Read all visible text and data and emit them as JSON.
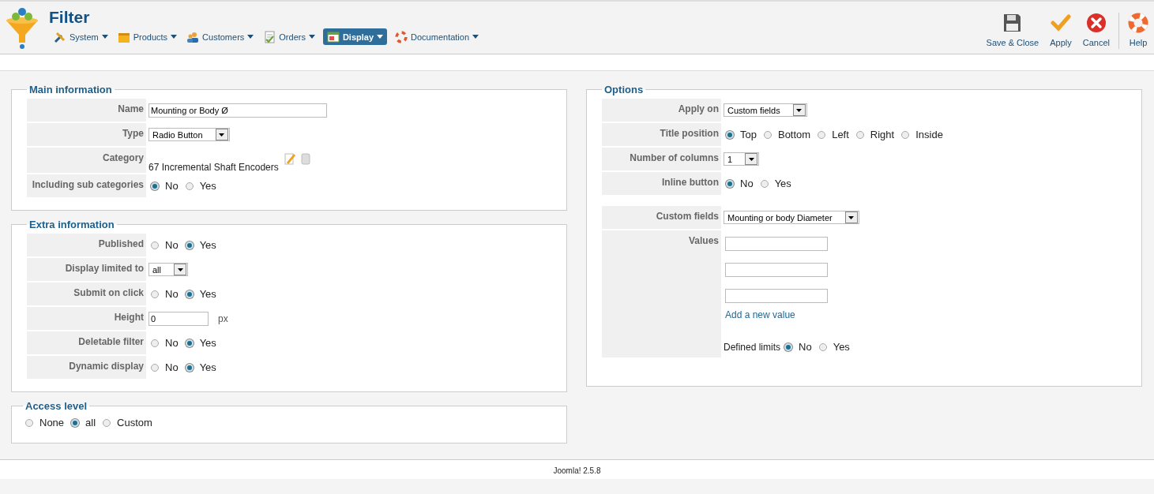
{
  "header": {
    "title": "Filter",
    "menu": [
      {
        "label": "System",
        "kind": "tools",
        "selected": false
      },
      {
        "label": "Products",
        "kind": "box",
        "selected": false
      },
      {
        "label": "Customers",
        "kind": "users",
        "selected": false
      },
      {
        "label": "Orders",
        "kind": "doc",
        "selected": false
      },
      {
        "label": "Display",
        "kind": "screen",
        "selected": true
      },
      {
        "label": "Documentation",
        "kind": "ring",
        "selected": false
      }
    ],
    "toolbar": [
      {
        "label": "Save & Close",
        "kind": "save"
      },
      {
        "label": "Apply",
        "kind": "apply"
      },
      {
        "label": "Cancel",
        "kind": "cancel"
      },
      {
        "label": "Help",
        "kind": "help"
      }
    ]
  },
  "left_panels": [
    {
      "title": "Main information",
      "rows": [
        {
          "kind": "text",
          "label": "Name",
          "value": "Mounting or Body Ø"
        },
        {
          "kind": "select",
          "label": "Type",
          "value": "Radio Button"
        },
        {
          "kind": "category",
          "label": "Category",
          "value": "67 Incremental Shaft Encoders"
        },
        {
          "kind": "radio",
          "label": "Including sub categories",
          "options": [
            {
              "label": "No",
              "selected": true
            },
            {
              "label": "Yes",
              "selected": false
            }
          ]
        }
      ]
    },
    {
      "title": "Extra information",
      "rows": [
        {
          "kind": "radio",
          "label": "Published",
          "options": [
            {
              "label": "No",
              "selected": false
            },
            {
              "label": "Yes",
              "selected": true
            }
          ]
        },
        {
          "kind": "select",
          "label": "Display limited to",
          "value": "all"
        },
        {
          "kind": "radio",
          "label": "Submit on click",
          "options": [
            {
              "label": "No",
              "selected": false
            },
            {
              "label": "Yes",
              "selected": true
            }
          ]
        },
        {
          "kind": "text",
          "label": "Height",
          "value": "0",
          "unit": "px"
        },
        {
          "kind": "radio",
          "label": "Deletable filter",
          "options": [
            {
              "label": "No",
              "selected": false
            },
            {
              "label": "Yes",
              "selected": true
            }
          ]
        },
        {
          "kind": "radio",
          "label": "Dynamic display",
          "options": [
            {
              "label": "No",
              "selected": false
            },
            {
              "label": "Yes",
              "selected": true
            }
          ]
        }
      ]
    }
  ],
  "access_level": {
    "title": "Access level",
    "options": [
      {
        "label": "None",
        "selected": false
      },
      {
        "label": "all",
        "selected": true
      },
      {
        "label": "Custom",
        "selected": false
      }
    ]
  },
  "options": {
    "title": "Options",
    "groups": [
      [
        {
          "kind": "select",
          "label": "Apply on",
          "value": "Custom fields"
        },
        {
          "kind": "radio",
          "label": "Title position",
          "options": [
            {
              "label": "Top",
              "selected": true
            },
            {
              "label": "Bottom",
              "selected": false
            },
            {
              "label": "Left",
              "selected": false
            },
            {
              "label": "Right",
              "selected": false
            },
            {
              "label": "Inside",
              "selected": false
            }
          ]
        },
        {
          "kind": "select",
          "label": "Number of columns",
          "value": "1"
        },
        {
          "kind": "radio",
          "label": "Inline button",
          "options": [
            {
              "label": "No",
              "selected": true
            },
            {
              "label": "Yes",
              "selected": false
            }
          ]
        }
      ],
      [
        {
          "kind": "select",
          "label": "Custom fields",
          "value": "Mounting or body Diameter"
        },
        {
          "kind": "values",
          "label": "Values",
          "link": "Add a new value",
          "limits": {
            "label": "Defined limits",
            "options": [
              {
                "label": "No",
                "selected": true
              },
              {
                "label": "Yes",
                "selected": false
              }
            ]
          }
        }
      ]
    ]
  },
  "footer": "Joomla! 2.5.8"
}
